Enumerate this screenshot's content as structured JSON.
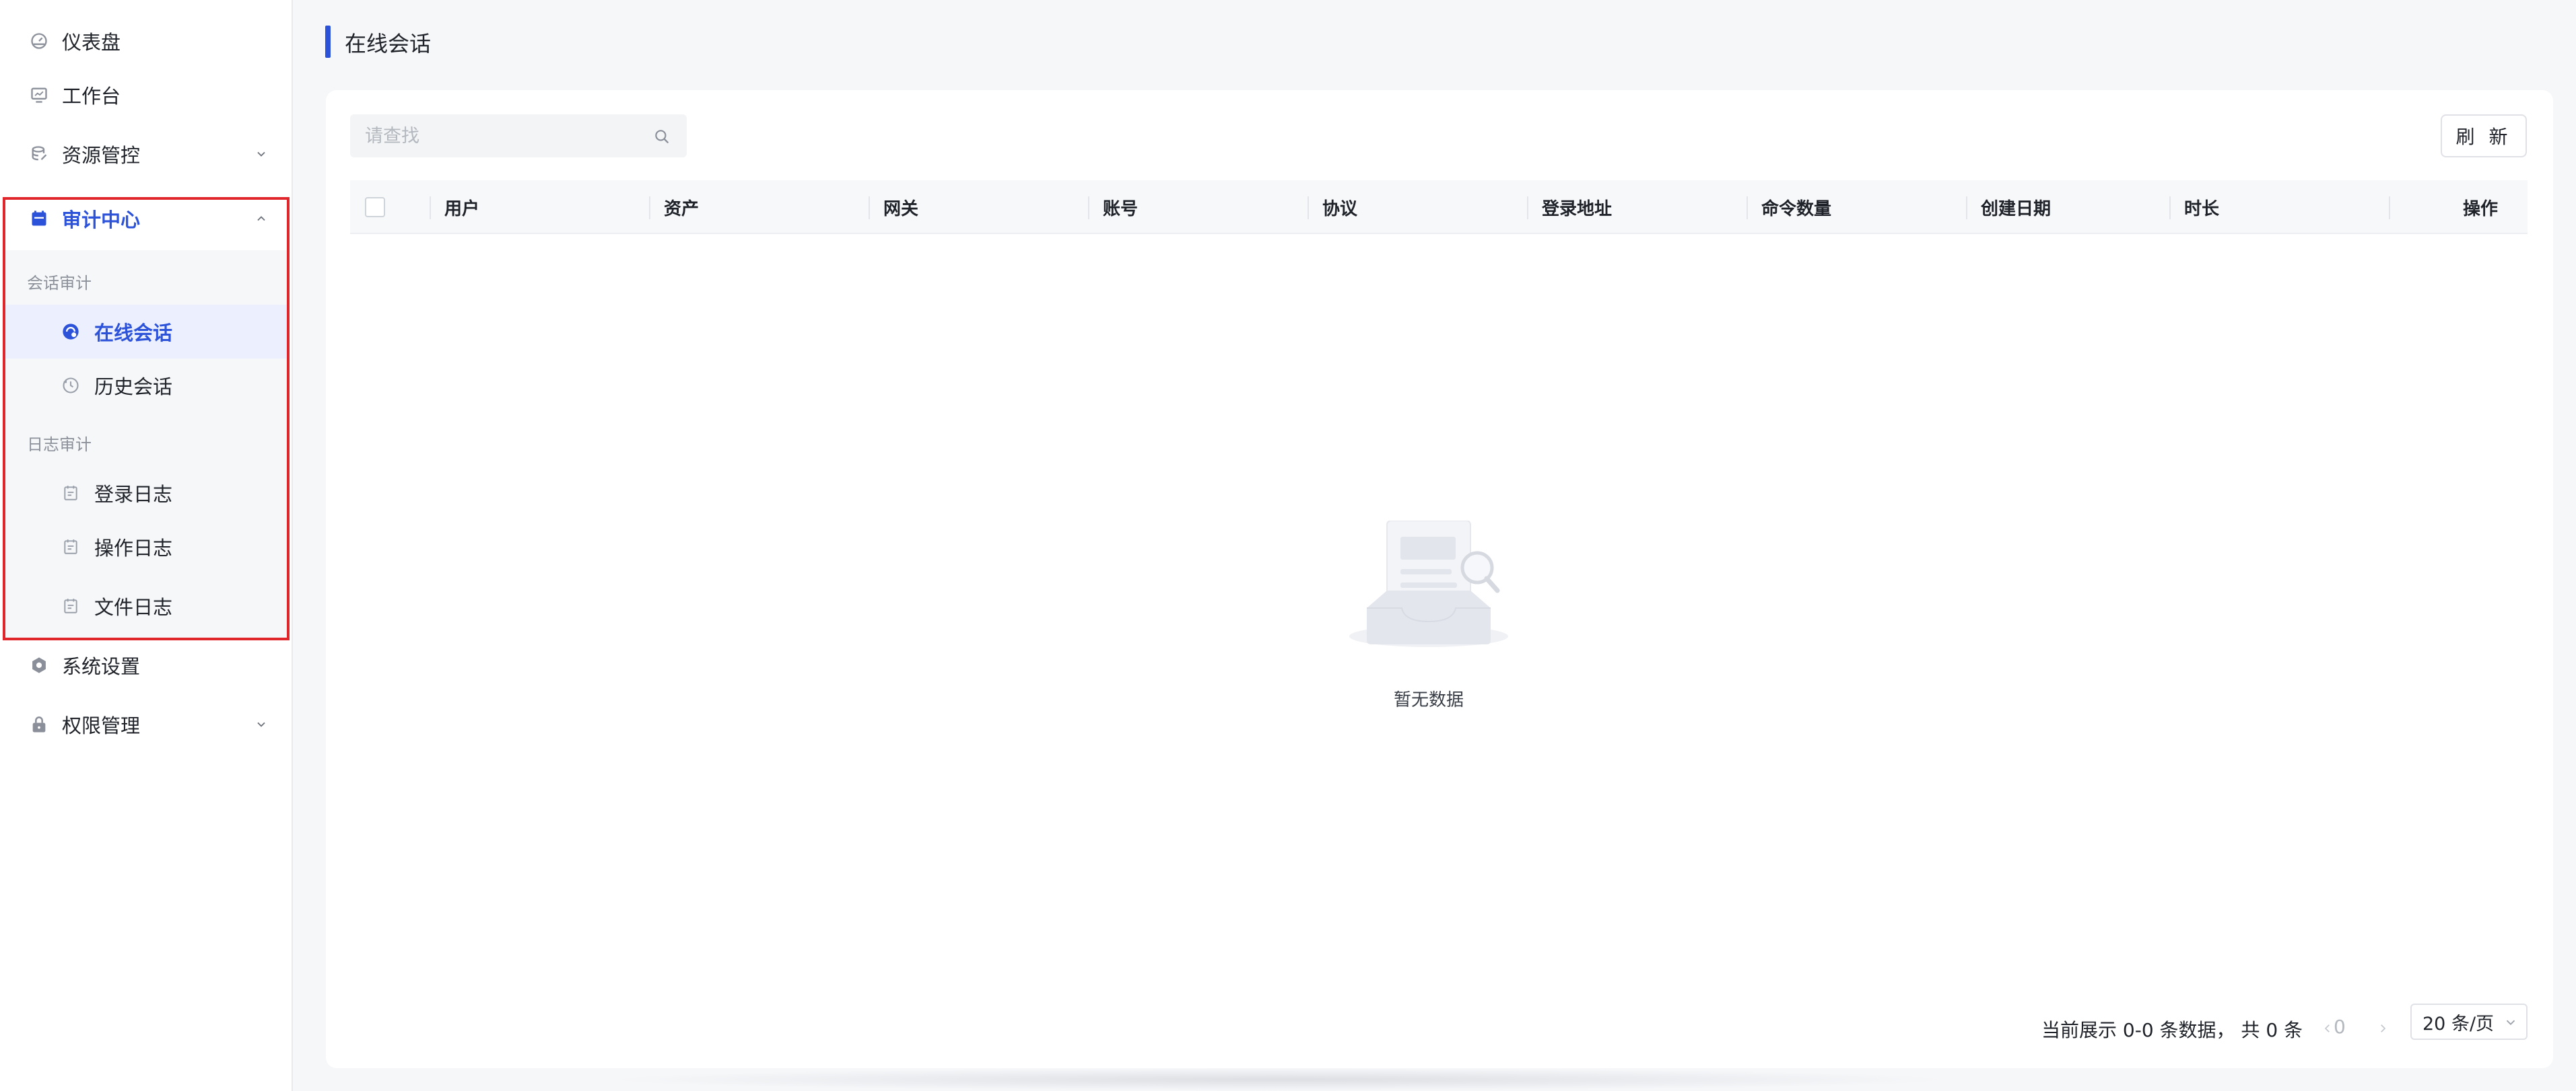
{
  "sidebar": {
    "items": [
      {
        "label": "仪表盘",
        "icon": "dashboard-icon"
      },
      {
        "label": "工作台",
        "icon": "workbench-icon"
      },
      {
        "label": "资源管控",
        "icon": "database-icon"
      },
      {
        "label": "审计中心",
        "icon": "calendar-icon"
      },
      {
        "label": "系统设置",
        "icon": "gear-icon"
      },
      {
        "label": "权限管理",
        "icon": "lock-icon"
      }
    ],
    "groups": {
      "session": "会话审计",
      "log": "日志审计"
    },
    "subitems": [
      {
        "label": "在线会话",
        "icon": "online-session-icon"
      },
      {
        "label": "历史会话",
        "icon": "history-icon"
      },
      {
        "label": "登录日志",
        "icon": "log-icon"
      },
      {
        "label": "操作日志",
        "icon": "log-icon"
      },
      {
        "label": "文件日志",
        "icon": "log-icon"
      }
    ]
  },
  "page": {
    "title": "在线会话"
  },
  "toolbar": {
    "search_placeholder": "请查找",
    "refresh_label": "刷 新"
  },
  "table": {
    "columns": [
      "用户",
      "资产",
      "网关",
      "账号",
      "协议",
      "登录地址",
      "命令数量",
      "创建日期",
      "时长",
      "操作"
    ],
    "empty_text": "暂无数据"
  },
  "pagination": {
    "info": "当前展示 0-0 条数据， 共 0 条",
    "current": "0",
    "page_size": "20 条/页"
  },
  "colors": {
    "accent": "#2b52d9",
    "highlight_border": "#e0262a"
  }
}
